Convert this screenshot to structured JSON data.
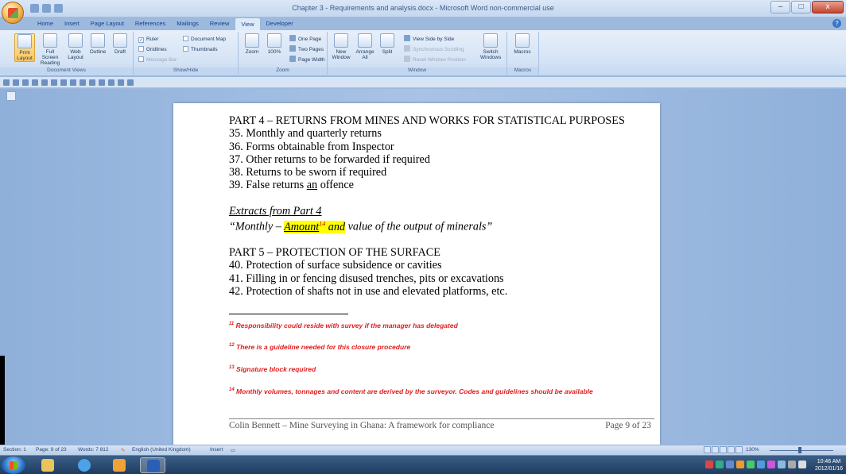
{
  "window": {
    "title": "Chapter 3 - Requirements and analysis.docx - Microsoft Word non-commercial use",
    "minimize": "–",
    "maximize": "□",
    "close": "x"
  },
  "ribbon_tabs": [
    "Home",
    "Insert",
    "Page Layout",
    "References",
    "Mailings",
    "Review",
    "View",
    "Developer"
  ],
  "active_tab": "View",
  "groups": {
    "document_views": {
      "label": "Document Views",
      "print_layout": "Print Layout",
      "full_screen_reading": "Full Screen Reading",
      "web_layout": "Web Layout",
      "outline": "Outline",
      "draft": "Draft"
    },
    "show_hide": {
      "label": "Show/Hide",
      "ruler": "Ruler",
      "gridlines": "Gridlines",
      "message_bar": "Message Bar",
      "document_map": "Document Map",
      "thumbnails": "Thumbnails",
      "check": "✓"
    },
    "zoom": {
      "label": "Zoom",
      "zoom": "Zoom",
      "hundred": "100%",
      "one_page": "One Page",
      "two_pages": "Two Pages",
      "page_width": "Page Width"
    },
    "window": {
      "label": "Window",
      "new_window": "New Window",
      "arrange_all": "Arrange All",
      "split": "Split",
      "view_side_by_side": "View Side by Side",
      "synchronous_scrolling": "Synchronous Scrolling",
      "reset_window_position": "Reset Window Position",
      "switch_windows": "Switch Windows"
    },
    "macros": {
      "label": "Macros",
      "macros": "Macros"
    }
  },
  "document": {
    "part4_heading": "PART 4 – RETURNS FROM MINES AND WORKS FOR STATISTICAL PURPOSES",
    "part4_items": [
      "35. Monthly and quarterly returns",
      "36. Forms obtainable from Inspector",
      "37. Other returns to be forwarded if required",
      "38. Returns to be sworn if required"
    ],
    "item39_prefix": "39. False returns ",
    "item39_underlined": "an",
    "item39_suffix": " offence",
    "extracts_heading": "Extracts from Part 4",
    "quote_start": "“Monthly – ",
    "quote_amount": "Amount",
    "quote_ref": "14",
    "quote_and": " and",
    "quote_end": " value of the output of minerals”",
    "part5_heading": "PART 5 – PROTECTION OF THE SURFACE",
    "part5_items": [
      "40. Protection of surface subsidence or cavities",
      "41. Filling in or fencing disused trenches, pits or excavations",
      "42. Protection of shafts not in use and elevated platforms, etc."
    ],
    "footnotes": [
      {
        "num": "11",
        "text": " Responsibility could reside with survey if the manager has delegated"
      },
      {
        "num": "12",
        "text": " There is a guideline needed for this closure procedure"
      },
      {
        "num": "13",
        "text": " Signature block required"
      },
      {
        "num": "14",
        "text": " Monthly volumes, tonnages and content are derived by the surveyor. Codes and guidelines should be available"
      }
    ],
    "footer_left": "Colin Bennett – Mine Surveying in Ghana: A framework for compliance",
    "footer_right": "Page 9 of 23"
  },
  "statusbar": {
    "section": "Section: 1",
    "page": "Page: 9 of 23",
    "words": "Words: 7 812",
    "language": "English (United Kingdom)",
    "mode": "Insert",
    "zoom": "130%"
  },
  "taskbar": {
    "time": "10:46 AM",
    "date": "2012/01/16"
  },
  "colors": {
    "footnote_red": "#e21d1d",
    "highlight": "#ffff00",
    "ribbon_blue": "#d4e3f5"
  }
}
